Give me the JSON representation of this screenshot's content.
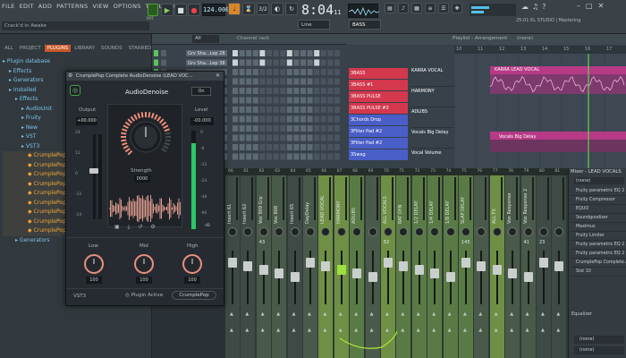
{
  "menu": {
    "items": [
      "FILE",
      "EDIT",
      "ADD",
      "PATTERNS",
      "VIEW",
      "OPTIONS",
      "TOOLS",
      "HELP"
    ]
  },
  "transport": {
    "pat_label": "PAT",
    "song_label": "SONG",
    "tempo": "124.000",
    "time": "8:04",
    "time_sub": "11",
    "snap": "Line",
    "channel": "BASS",
    "cpu_text": "25:01 KL STUDIO | Mastering"
  },
  "hint": {
    "window_hint": "Crack'd in Awake"
  },
  "browser": {
    "tabs": [
      "ALL",
      "PROJECT",
      "PLUGINS",
      "LIBRARY",
      "SOUNDS",
      "STARRED"
    ],
    "tree": [
      {
        "label": "Plugin database",
        "kind": "folder",
        "level": 0
      },
      {
        "label": "Effects",
        "kind": "folder",
        "level": 1
      },
      {
        "label": "Generators",
        "kind": "folder",
        "level": 1
      },
      {
        "label": "Installed",
        "kind": "folder",
        "level": 1
      },
      {
        "label": "Effects",
        "kind": "folder",
        "level": 2
      },
      {
        "label": "AudioUnit",
        "kind": "folder",
        "level": 3
      },
      {
        "label": "Fruity",
        "kind": "folder",
        "level": 3
      },
      {
        "label": "New",
        "kind": "folder",
        "level": 3
      },
      {
        "label": "VST",
        "kind": "folder",
        "level": 3
      },
      {
        "label": "VST3",
        "kind": "folder",
        "level": 3
      },
      {
        "label": "CrumplePop",
        "kind": "plug",
        "level": 4
      },
      {
        "label": "CrumplePop",
        "kind": "plug",
        "level": 4
      },
      {
        "label": "CrumplePop",
        "kind": "plug",
        "level": 4
      },
      {
        "label": "CrumplePop",
        "kind": "plug",
        "level": 4
      },
      {
        "label": "CrumplePop",
        "kind": "plug",
        "level": 4
      },
      {
        "label": "CrumplePop",
        "kind": "plug",
        "level": 4
      },
      {
        "label": "CrumplePop",
        "kind": "plug",
        "level": 4
      },
      {
        "label": "CrumplePop",
        "kind": "plug",
        "level": 4
      },
      {
        "label": "CrumplePop",
        "kind": "plug",
        "level": 4
      },
      {
        "label": "Generators",
        "kind": "folder",
        "level": 2
      }
    ]
  },
  "plugin": {
    "title": "CrumplePop Complete AudioDenoise (LEAD VOC...",
    "name": "AudioDenoise",
    "power_label": "On",
    "output_label": "Output",
    "output_value": "+00.000",
    "level_label": "Level",
    "level_value": "-00.000",
    "strength_label": "Strength",
    "strength_value": "0000",
    "low_label": "Low",
    "mid_label": "Mid",
    "high_label": "High",
    "low_value": "100",
    "mid_value": "100",
    "high_value": "100",
    "db_marks": [
      "24",
      "12",
      "0",
      "-12",
      "-24"
    ],
    "level_marks": [
      "0",
      "-6",
      "-12",
      "-24",
      "-48",
      "-96"
    ],
    "level_unit": "dB",
    "format": "VST3",
    "plugin_active": "Plugin Active",
    "brand": "CrumplePop"
  },
  "rack": {
    "filter": "All",
    "title": "Channel rack",
    "channels": [
      {
        "label": "Grv Sha...Lep 28"
      },
      {
        "label": "Grv Sha...Lep 38"
      },
      {
        "label": ""
      },
      {
        "label": ""
      },
      {
        "label": ""
      },
      {
        "label": ""
      },
      {
        "label": ""
      },
      {
        "label": ""
      },
      {
        "label": ""
      },
      {
        "label": ""
      },
      {
        "label": ""
      },
      {
        "label": ""
      }
    ],
    "patterns": [
      "3BASS",
      "3BASS #1",
      "3BASS PULSE",
      "3BASS PULSE #3",
      "3Chords Drop",
      "3Filter Pad #2",
      "3Filter Pad #2",
      "3Swag"
    ]
  },
  "playlist": {
    "title": "Playlist - Arrangement",
    "arrangement": "(none)",
    "tracks": [
      {
        "label": "KARRA VOCAL",
        "color": "#d040a0"
      },
      {
        "label": "HARMONY",
        "color": "#d040a0"
      },
      {
        "label": "ADLIBS",
        "color": "#d040a0"
      },
      {
        "label": "Vocals Big Delay",
        "color": "#d040a0"
      },
      {
        "label": "Vocal Volume",
        "color": "#d040a0"
      }
    ],
    "clip_label": "KARRA LEAD VOCAL",
    "clip2_label": "Vocals Big Delay",
    "ruler": [
      "10",
      "11",
      "12",
      "13",
      "14",
      "15",
      "16",
      "17"
    ]
  },
  "mixer": {
    "strips": [
      {
        "label": "Insert 61"
      },
      {
        "label": "Insert 62"
      },
      {
        "label": "Vox 909 Grp"
      },
      {
        "label": "Vox 808"
      },
      {
        "label": "Insert 65"
      },
      {
        "label": "DayDelay"
      },
      {
        "label": "LEAD VOCAL"
      },
      {
        "label": "HARMONY"
      },
      {
        "label": "ADLIBS"
      },
      {
        "label": ""
      },
      {
        "label": "ALL VOCALS"
      },
      {
        "label": "RAT DYN"
      },
      {
        "label": "1/2 DELAY"
      },
      {
        "label": "1/4 DELAY"
      },
      {
        "label": "1/8 DELAY"
      },
      {
        "label": "SLAP DELAY"
      },
      {
        "label": ""
      },
      {
        "label": "ALL FX"
      },
      {
        "label": "Vox Response"
      },
      {
        "label": "Vox Response 2"
      },
      {
        "label": ""
      },
      {
        "label": ""
      }
    ],
    "values": [
      "",
      "",
      "43",
      "",
      "",
      "",
      "",
      "",
      "",
      "",
      "62",
      "",
      "",
      "",
      "",
      "145",
      "",
      "",
      "",
      "41",
      "23",
      ""
    ],
    "numbers": [
      "66",
      "61",
      "62",
      "63",
      "64",
      "65",
      "66",
      "67",
      "68",
      "69",
      "70",
      "71",
      "72",
      "73",
      "74",
      "75",
      "76",
      "77",
      "78",
      "79",
      "80",
      "81"
    ]
  },
  "inspector": {
    "title": "Mixer - LEAD VOCALS",
    "preset": "(none)",
    "slots": [
      "Fruity parametric EQ 2",
      "Fruity Compressor",
      "EQUO",
      "Soundgoodizer",
      "Maximus",
      "Fruity Limiter",
      "Fruity parametric EQ 2",
      "Fruity parametric EQ 2",
      "CrumplePop Complete Aud",
      "Slot 10"
    ],
    "equalizer": "Equalizer",
    "out_label": "(none)"
  }
}
